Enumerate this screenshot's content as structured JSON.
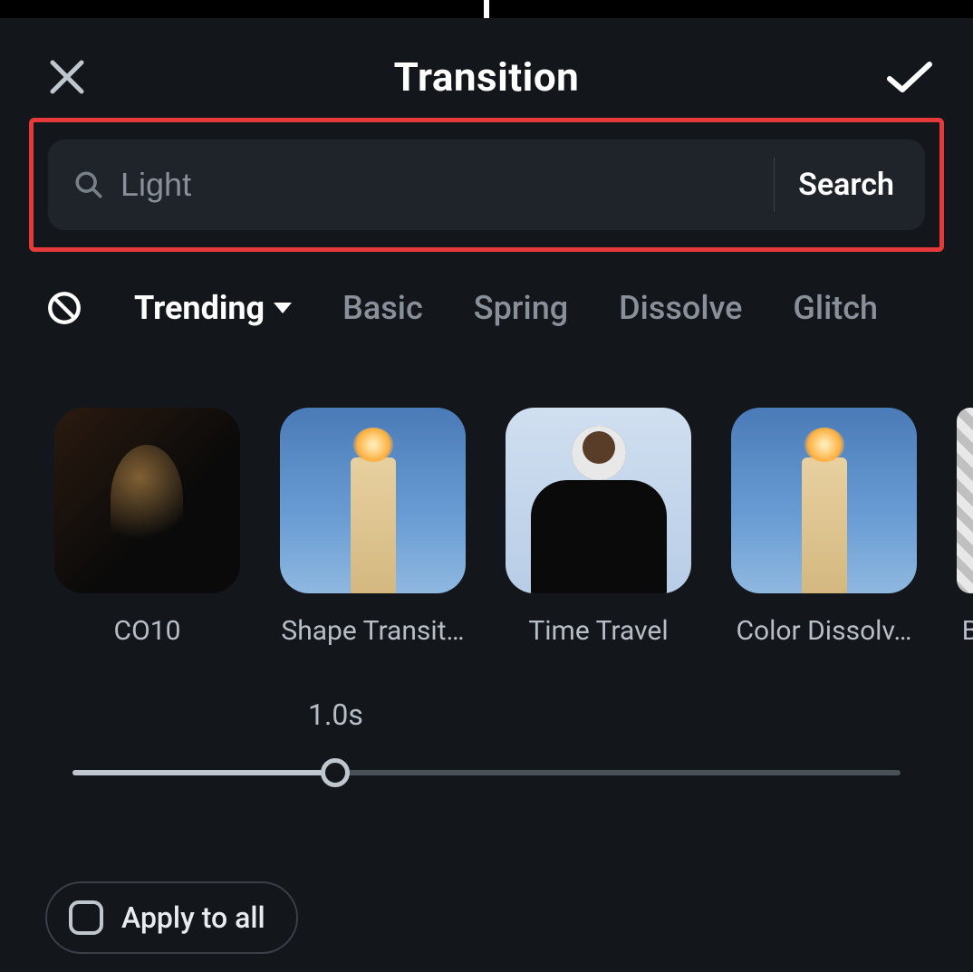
{
  "header": {
    "title": "Transition"
  },
  "search": {
    "value": "Light",
    "button_label": "Search"
  },
  "categories": {
    "items": [
      {
        "label": "Trending",
        "active": true,
        "dropdown": true
      },
      {
        "label": "Basic"
      },
      {
        "label": "Spring"
      },
      {
        "label": "Dissolve"
      },
      {
        "label": "Glitch"
      }
    ]
  },
  "gallery": {
    "items": [
      {
        "label": "CO10"
      },
      {
        "label": "Shape Transit…"
      },
      {
        "label": "Time Travel"
      },
      {
        "label": "Color Dissolv…"
      },
      {
        "label": "B"
      }
    ]
  },
  "slider": {
    "value_label": "1.0s"
  },
  "apply_all": {
    "label": "Apply to all"
  }
}
